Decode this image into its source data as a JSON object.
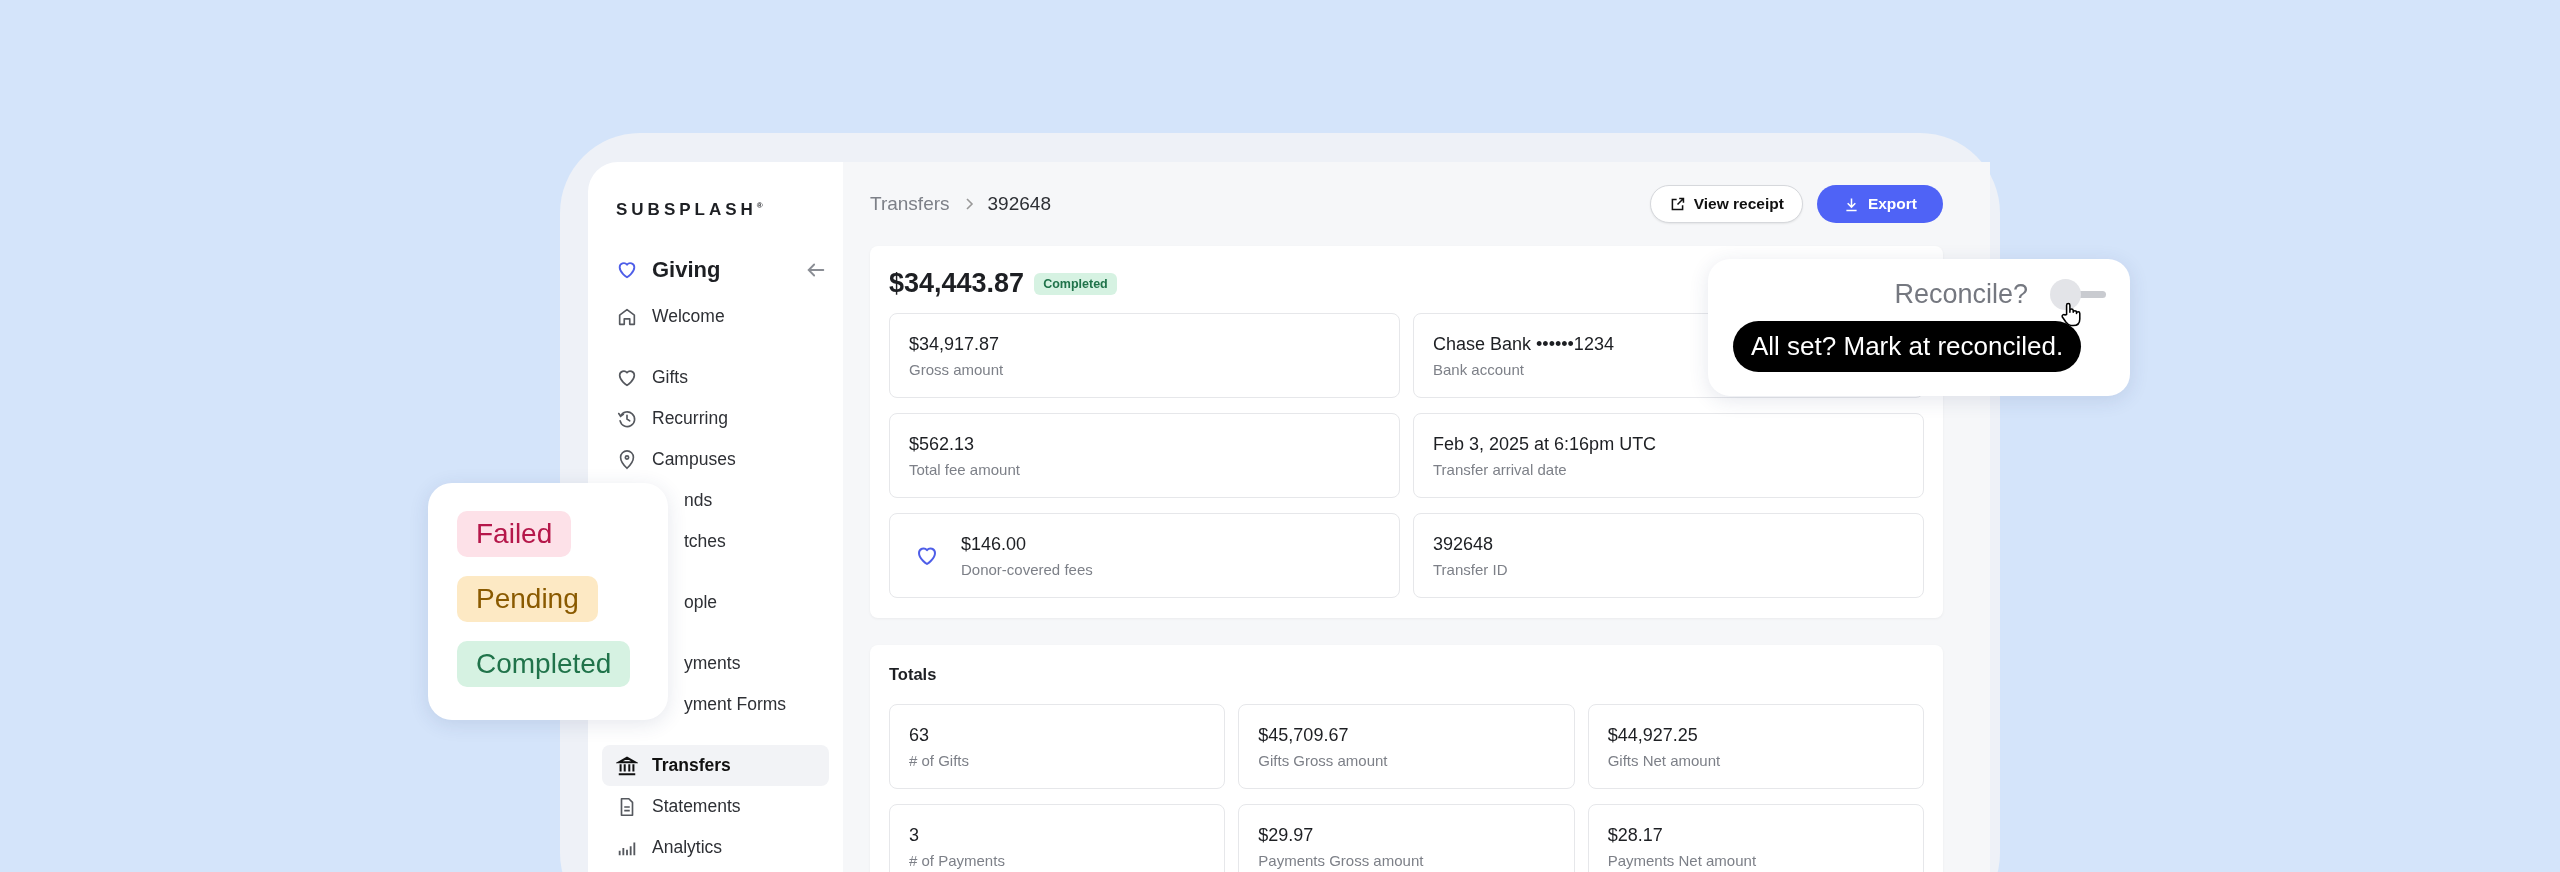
{
  "sidebar": {
    "logo": "SUBSPLASH$^{®}$",
    "section": "Giving",
    "groups": [
      [
        {
          "label": "Welcome",
          "kind": "home",
          "selected": false
        }
      ],
      [
        {
          "label": "Gifts",
          "kind": "heart",
          "selected": false
        },
        {
          "label": "Recurring",
          "kind": "history",
          "selected": false
        },
        {
          "label": "Campuses",
          "kind": "pin",
          "selected": false
        },
        {
          "label": "nds",
          "kind": "covered",
          "selected": false
        },
        {
          "label": "tches",
          "kind": "covered",
          "selected": false
        }
      ],
      [
        {
          "label": "ople",
          "kind": "covered",
          "selected": false
        }
      ],
      [
        {
          "label": "yments",
          "kind": "covered",
          "selected": false
        },
        {
          "label": "yment Forms",
          "kind": "covered",
          "selected": false
        }
      ],
      [
        {
          "label": "Transfers",
          "kind": "bank",
          "selected": true
        },
        {
          "label": "Statements",
          "kind": "document",
          "selected": false
        },
        {
          "label": "Analytics",
          "kind": "chart",
          "selected": false
        }
      ]
    ]
  },
  "breadcrumb": [
    "Transfers",
    "392648"
  ],
  "buttons": [
    {
      "label": "View receipt",
      "kind": "secondary"
    },
    {
      "label": "Export",
      "kind": "primary"
    }
  ],
  "transfer": {
    "amount": "$34,443.87",
    "status": {
      "label": "Completed",
      "kind": "completed"
    },
    "tiles": [
      {
        "value": "$34,917.87",
        "label": "Gross amount",
        "kind": "plain"
      },
      {
        "value": "Chase Bank ••••••1234",
        "label": "Bank account",
        "kind": "plain"
      },
      {
        "value": "$562.13",
        "label": "Total fee amount",
        "kind": "plain"
      },
      {
        "value": "Feb 3, 2025 at 6:16pm UTC",
        "label": "Transfer arrival date",
        "kind": "plain"
      },
      {
        "value": "$146.00",
        "label": "Donor-covered fees",
        "kind": "heart"
      },
      {
        "value": "392648",
        "label": "Transfer ID",
        "kind": "plain"
      }
    ]
  },
  "totals": {
    "title": "Totals",
    "tiles": [
      {
        "value": "63",
        "label": "# of Gifts"
      },
      {
        "value": "$45,709.67",
        "label": "Gifts Gross amount"
      },
      {
        "value": "$44,927.25",
        "label": "Gifts Net amount"
      },
      {
        "value": "3",
        "label": "# of Payments"
      },
      {
        "value": "$29.97",
        "label": "Payments Gross amount"
      },
      {
        "value": "$28.17",
        "label": "Payments Net amount"
      }
    ]
  },
  "status_legend": [
    {
      "label": "Failed",
      "kind": "failed"
    },
    {
      "label": "Pending",
      "kind": "pending"
    },
    {
      "label": "Completed",
      "kind": "completed"
    }
  ],
  "reconcile": {
    "label": "Reconcile?",
    "on": false,
    "tooltip": "All set? Mark at reconciled."
  }
}
